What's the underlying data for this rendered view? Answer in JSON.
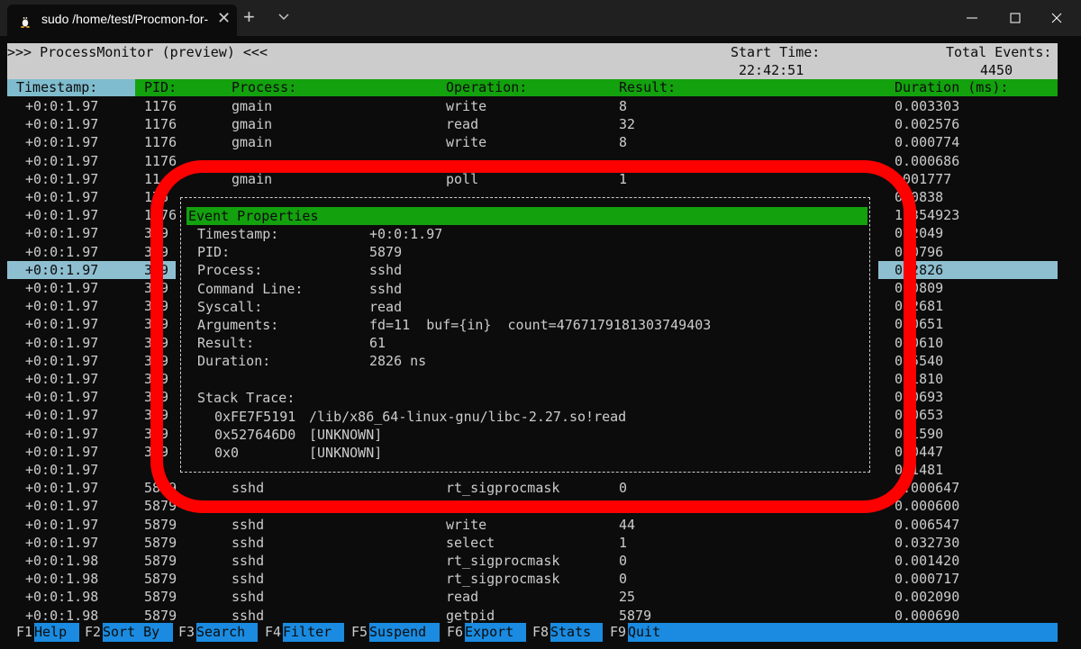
{
  "window": {
    "tab_title": "sudo  /home/test/Procmon-for-",
    "tab_close": "✕",
    "new_tab": "+",
    "icons": [
      "linux-tux-icon",
      "chevron-down-icon",
      "minimize-icon",
      "maximize-icon",
      "close-icon"
    ]
  },
  "header": {
    "title": ">>> ProcessMonitor (preview) <<<",
    "start_time_label": "Start Time:",
    "start_time": "22:42:51",
    "total_events_label": "Total Events:",
    "total_events": "4450"
  },
  "columns": {
    "timestamp": "Timestamp:",
    "pid": "PID:",
    "process": "Process:",
    "operation": "Operation:",
    "result": "Result:",
    "duration": "Duration (ms):"
  },
  "rows": [
    {
      "ts": "+0:0:1.97",
      "pid": "1176",
      "proc": "gmain",
      "op": "write",
      "res": "8",
      "dur": "0.003303"
    },
    {
      "ts": "+0:0:1.97",
      "pid": "1176",
      "proc": "gmain",
      "op": "read",
      "res": "32",
      "dur": "0.002576"
    },
    {
      "ts": "+0:0:1.97",
      "pid": "1176",
      "proc": "gmain",
      "op": "write",
      "res": "8",
      "dur": "0.000774"
    },
    {
      "ts": "+0:0:1.97",
      "pid": "1176",
      "proc": "",
      "op": "",
      "res": "",
      "dur": "0.000686"
    },
    {
      "ts": "+0:0:1.97",
      "pid": "11",
      "proc": "gmain",
      "op": "poll",
      "res": "1",
      "dur": ".001777"
    },
    {
      "ts": "+0:0:1.97",
      "pid": "176",
      "proc": "",
      "op": "",
      "res": "",
      "dur": "000838"
    },
    {
      "ts": "+0:0:1.97",
      "pid": "1176",
      "proc": "",
      "op": "",
      "res": "",
      "dur": "1.354923"
    },
    {
      "ts": "+0:0:1.97",
      "pid": "379",
      "proc": "",
      "op": "",
      "res": "",
      "dur": "002049"
    },
    {
      "ts": "+0:0:1.97",
      "pid": "379",
      "proc": "",
      "op": "",
      "res": "",
      "dur": "000796"
    },
    {
      "ts": "+0:0:1.97",
      "pid": "379",
      "proc": "",
      "op": "",
      "res": "",
      "dur": "002826",
      "selected": true
    },
    {
      "ts": "+0:0:1.97",
      "pid": "379",
      "proc": "",
      "op": "",
      "res": "",
      "dur": "000809"
    },
    {
      "ts": "+0:0:1.97",
      "pid": "379",
      "proc": "",
      "op": "",
      "res": "",
      "dur": "002681"
    },
    {
      "ts": "+0:0:1.97",
      "pid": "379",
      "proc": "",
      "op": "",
      "res": "",
      "dur": "000651"
    },
    {
      "ts": "+0:0:1.97",
      "pid": "379",
      "proc": "",
      "op": "",
      "res": "",
      "dur": "000610"
    },
    {
      "ts": "+0:0:1.97",
      "pid": "379",
      "proc": "",
      "op": "",
      "res": "",
      "dur": "025540"
    },
    {
      "ts": "+0:0:1.97",
      "pid": "379",
      "proc": "",
      "op": "",
      "res": "",
      "dur": "011810"
    },
    {
      "ts": "+0:0:1.97",
      "pid": "379",
      "proc": "",
      "op": "",
      "res": "",
      "dur": "000693"
    },
    {
      "ts": "+0:0:1.97",
      "pid": "379",
      "proc": "",
      "op": "",
      "res": "",
      "dur": "000653"
    },
    {
      "ts": "+0:0:1.97",
      "pid": "379",
      "proc": "",
      "op": "",
      "res": "",
      "dur": "001590"
    },
    {
      "ts": "+0:0:1.97",
      "pid": "379",
      "proc": "",
      "op": "",
      "res": "",
      "dur": "000447"
    },
    {
      "ts": "+0:0:1.97",
      "pid": "",
      "proc": "",
      "op": "",
      "res": "",
      "dur": "001481"
    },
    {
      "ts": "+0:0:1.97",
      "pid": "5879",
      "proc": "sshd",
      "op": "rt_sigprocmask",
      "res": "0",
      "dur": "0.000647"
    },
    {
      "ts": "+0:0:1.97",
      "pid": "5879",
      "proc": "",
      "op": "",
      "res": "",
      "dur": "0.000600"
    },
    {
      "ts": "+0:0:1.97",
      "pid": "5879",
      "proc": "sshd",
      "op": "write",
      "res": "44",
      "dur": "0.006547"
    },
    {
      "ts": "+0:0:1.97",
      "pid": "5879",
      "proc": "sshd",
      "op": "select",
      "res": "1",
      "dur": "0.032730"
    },
    {
      "ts": "+0:0:1.98",
      "pid": "5879",
      "proc": "sshd",
      "op": "rt_sigprocmask",
      "res": "0",
      "dur": "0.001420"
    },
    {
      "ts": "+0:0:1.98",
      "pid": "5879",
      "proc": "sshd",
      "op": "rt_sigprocmask",
      "res": "0",
      "dur": "0.000717"
    },
    {
      "ts": "+0:0:1.98",
      "pid": "5879",
      "proc": "sshd",
      "op": "read",
      "res": "25",
      "dur": "0.002090"
    },
    {
      "ts": "+0:0:1.98",
      "pid": "5879",
      "proc": "sshd",
      "op": "getpid",
      "res": "5879",
      "dur": "0.000690"
    }
  ],
  "dialog": {
    "title": "Event Properties",
    "fields": [
      {
        "label": "Timestamp:",
        "value": "+0:0:1.97"
      },
      {
        "label": "PID:",
        "value": "5879"
      },
      {
        "label": "Process:",
        "value": "sshd"
      },
      {
        "label": "Command Line:",
        "value": "sshd"
      },
      {
        "label": "Syscall:",
        "value": "read"
      },
      {
        "label": "Arguments:",
        "value": "fd=11  buf={in}  count=4767179181303749403"
      },
      {
        "label": "Result:",
        "value": "61"
      },
      {
        "label": "Duration:",
        "value": "2826 ns"
      }
    ],
    "stack_label": "Stack Trace:",
    "stack": [
      {
        "addr": "0xFE7F5191",
        "sym": "/lib/x86_64-linux-gnu/libc-2.27.so!read"
      },
      {
        "addr": "0x527646D0",
        "sym": "[UNKNOWN]"
      },
      {
        "addr": "0x0",
        "sym": "[UNKNOWN]"
      }
    ]
  },
  "footer": [
    {
      "key": "F1",
      "label": "Help"
    },
    {
      "key": "F2",
      "label": "Sort By"
    },
    {
      "key": "F3",
      "label": "Search"
    },
    {
      "key": "F4",
      "label": "Filter"
    },
    {
      "key": "F5",
      "label": "Suspend"
    },
    {
      "key": "F6",
      "label": "Export"
    },
    {
      "key": "F8",
      "label": "Stats"
    },
    {
      "key": "F9",
      "label": "Quit"
    }
  ],
  "colors": {
    "terminal_bg": "#0c0c0c",
    "text": "#cccccc",
    "header_bar": "#cccccc",
    "column_header": "#13a10e",
    "selection": "#8ebfd0",
    "footer_label": "#1a8be0",
    "annotation": "#ff0000"
  }
}
